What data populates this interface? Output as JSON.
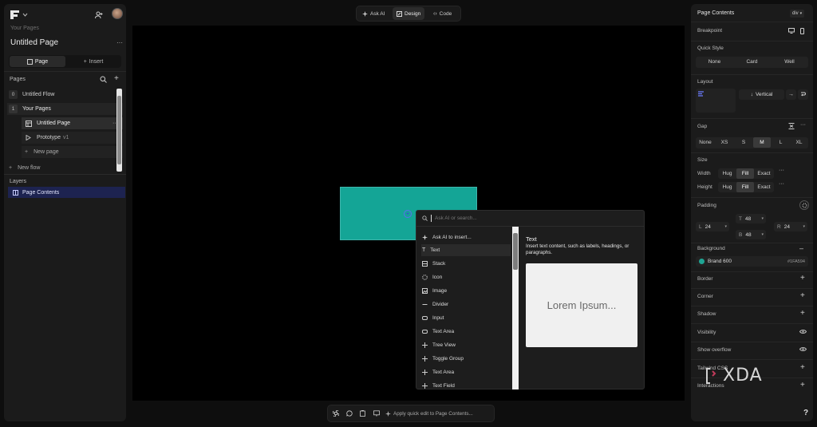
{
  "left": {
    "your_pages_label": "Your Pages",
    "page_title": "Untitled Page",
    "tabs": [
      "Page",
      "Insert"
    ],
    "pages_label": "Pages",
    "tree": [
      {
        "num": "0",
        "label": "Untitled Flow"
      },
      {
        "num": "1",
        "label": "Your Pages"
      },
      {
        "label": "Untitled Page"
      },
      {
        "label": "Prototype",
        "suffix": "v1"
      },
      {
        "label": "New page"
      }
    ],
    "new_flow": "New flow",
    "layers_label": "Layers",
    "layers": [
      "Page Contents"
    ]
  },
  "toolbar": {
    "ask_ai": "Ask AI",
    "design": "Design",
    "code": "Code"
  },
  "popup": {
    "search_placeholder": "Ask AI or search...",
    "items": [
      "Ask AI to insert...",
      "Text",
      "Stack",
      "Icon",
      "Image",
      "Divider",
      "Input",
      "Text Area",
      "Tree View",
      "Toggle Group",
      "Text Area",
      "Text Field"
    ],
    "preview_title": "Text",
    "preview_desc": "Insert text content, such as labels, headings, or paragraphs.",
    "preview_sample": "Lorem Ipsum..."
  },
  "right": {
    "header": "Page Contents",
    "tag": "div",
    "breakpoint": "Breakpoint",
    "quick_style": "Quick Style",
    "quick_options": [
      "None",
      "Card",
      "Well"
    ],
    "layout": "Layout",
    "layout_dir": "Vertical",
    "gap": "Gap",
    "gap_options": [
      "None",
      "XS",
      "S",
      "M",
      "L",
      "XL"
    ],
    "size": "Size",
    "width_label": "Width",
    "height_label": "Height",
    "size_options": [
      "Hug",
      "Fill",
      "Exact"
    ],
    "padding": "Padding",
    "pad": {
      "t_label": "T",
      "t": "48",
      "l_label": "L",
      "l": "24",
      "r_label": "R",
      "r": "24",
      "b_label": "B",
      "b": "48"
    },
    "background": "Background",
    "bg_name": "Brand 600",
    "bg_hex": "#1FA594",
    "sections": [
      "Border",
      "Corner",
      "Shadow",
      "Visibility",
      "Show overflow",
      "Tailwind CSS",
      "Interactions"
    ]
  },
  "bottom": {
    "quick_edit": "Apply quick edit to Page Contents..."
  },
  "watermark": "XDA",
  "help": "?",
  "colors": {
    "teal": "#14a596",
    "accent": "#5b6cf0",
    "brand": "#1FA594"
  }
}
